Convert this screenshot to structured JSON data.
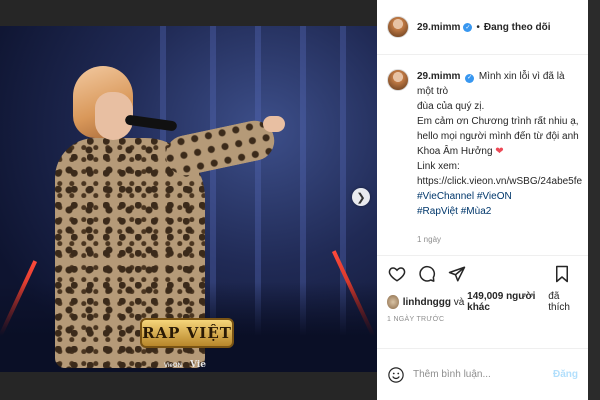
{
  "post": {
    "username": "29.mimm",
    "follow_status": "Đang theo dõi",
    "caption_lines": [
      "Mình xin lỗi vì đã là một trò",
      "đùa của quý zị.",
      "Em cảm ơn Chương trình rất nhiu ạ,",
      "hello mọi người mình đến từ đội anh",
      "Khoa Âm Hưởng"
    ],
    "link_label": "Link xem:",
    "link_url": "https://click.vieon.vn/wSBG/24abe5fe",
    "hashtags_line1": "#VieChannel #VieON",
    "hashtags_line2": "#RapViệt #Mùa2",
    "caption_time": "1 ngày",
    "likes_user": "linhdnggg",
    "likes_connector": "và",
    "likes_count": "149,009 người khác",
    "likes_suffix": "đã thích",
    "date": "1 NGÀY TRƯỚC",
    "comment_placeholder": "Thêm bình luận...",
    "post_button": "Đăng"
  },
  "media": {
    "show_logo_text": "RAP VIỆT",
    "sponsor_left": "VieON",
    "sponsor_right": "Vie"
  },
  "icons": {
    "verified": "verified-badge-icon",
    "like": "heart-outline-icon",
    "comment": "comment-bubble-icon",
    "share": "paper-plane-icon",
    "save": "bookmark-icon",
    "emoji": "smiley-icon",
    "next": "chevron-right-icon",
    "heart_emoji": "red-heart-icon"
  },
  "colors": {
    "verified_blue": "#3897f0",
    "link_blue": "#00376b",
    "post_button_disabled": "#b2dffc",
    "heart_red": "#ed4956"
  }
}
